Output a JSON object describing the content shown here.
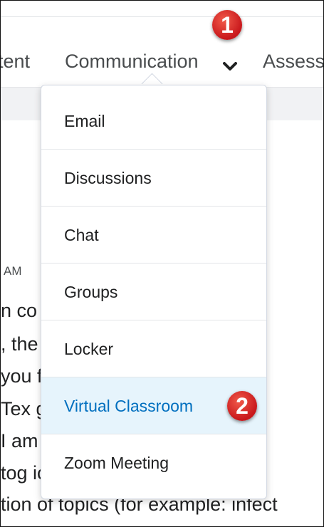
{
  "nav": {
    "items": [
      "Content",
      "Communication",
      "Assessments"
    ],
    "visible_labels": [
      "tent",
      "Communication",
      "Assess"
    ]
  },
  "badges": [
    "1",
    "2"
  ],
  "background": {
    "timestamp": "AM",
    "lines": [
      "n co                                     e: HIST",
      ", the                                    rse. Ty",
      " you                                     from",
      " Tex                                    g this c",
      "I am                                    to kno",
      " tog                                     ics the",
      "tion of topics (for example: infect"
    ]
  },
  "dropdown": {
    "items": [
      {
        "label": "Email",
        "active": false
      },
      {
        "label": "Discussions",
        "active": false
      },
      {
        "label": "Chat",
        "active": false
      },
      {
        "label": "Groups",
        "active": false
      },
      {
        "label": "Locker",
        "active": false
      },
      {
        "label": "Virtual Classroom",
        "active": true
      },
      {
        "label": "Zoom Meeting",
        "active": false
      }
    ]
  },
  "colors": {
    "active_bg": "#e6f4fc",
    "active_text": "#006fbf",
    "badge": "#d7261e"
  }
}
